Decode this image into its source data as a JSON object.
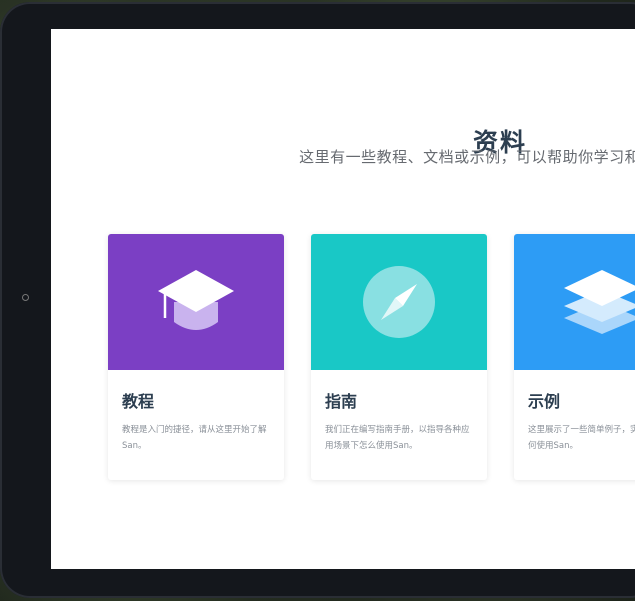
{
  "page": {
    "title": "资料",
    "subtitle": "这里有一些教程、文档或示例，可以帮助你学习和使用San"
  },
  "cards": [
    {
      "title": "教程",
      "description": "教程是入门的捷径，请从这里开始了解San。",
      "color": "#7b3fc4",
      "icon": "graduation-cap-icon"
    },
    {
      "title": "指南",
      "description": "我们正在编写指南手册，以指导各种应用场景下怎么使用San。",
      "color": "#19c8c6",
      "icon": "compass-icon"
    },
    {
      "title": "示例",
      "description": "这里展示了一些简单例子，实际项目如何使用San。",
      "color": "#2d9cf5",
      "icon": "layers-icon"
    }
  ]
}
